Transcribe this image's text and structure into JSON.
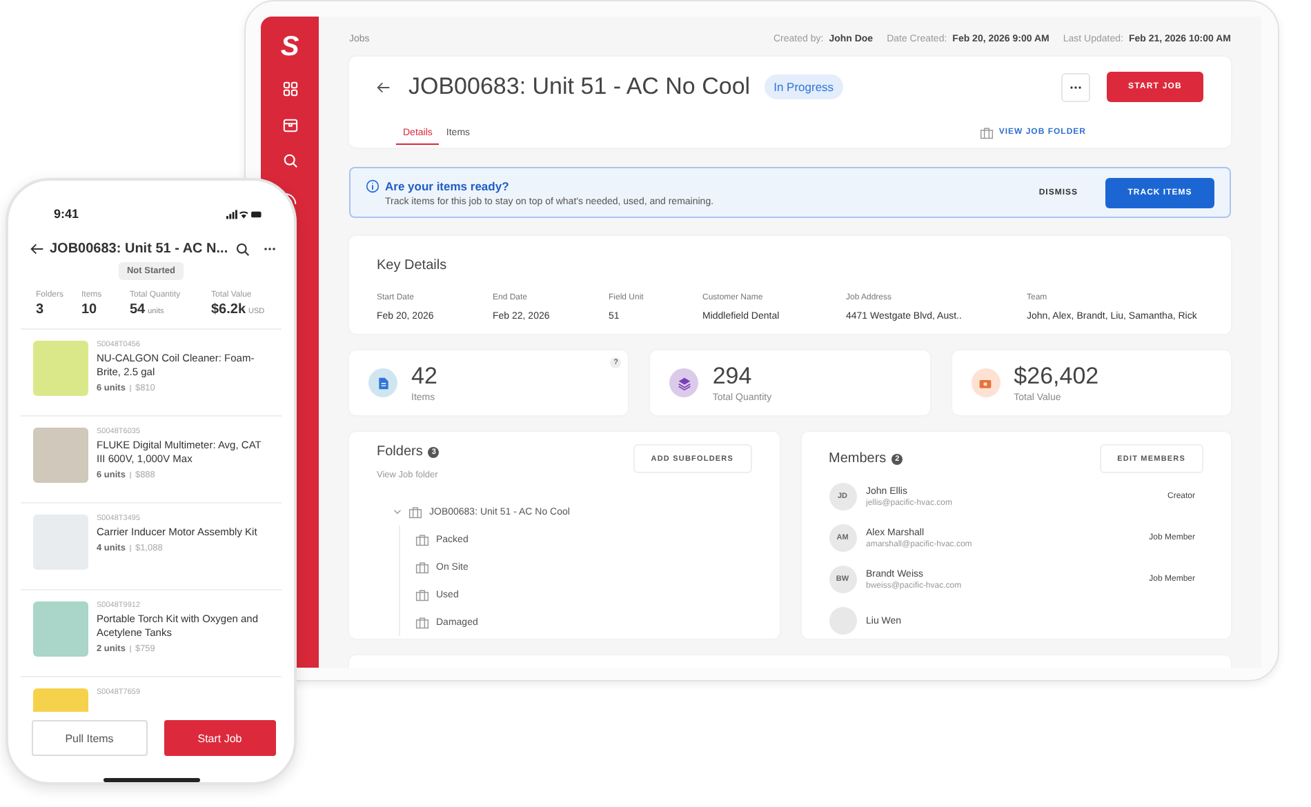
{
  "tablet": {
    "breadcrumb": "Jobs",
    "meta": [
      {
        "label": "Created by:",
        "value": "John Doe"
      },
      {
        "label": "Date Created:",
        "value": "Feb 20, 2026 9:00 AM"
      },
      {
        "label": "Last Updated:",
        "value": "Feb 21, 2026 10:00 AM"
      }
    ],
    "sidebar": {
      "logo": "S",
      "items": [
        {
          "kind": "grid"
        },
        {
          "kind": "box"
        },
        {
          "kind": "search"
        },
        {
          "kind": "signal"
        }
      ]
    },
    "job": {
      "title": "JOB00683: Unit 51 - AC No Cool",
      "status": "In Progress",
      "start_button": "START JOB",
      "folder_link": "VIEW JOB FOLDER",
      "tabs": [
        {
          "label": "Details",
          "selected": true
        },
        {
          "label": "Items",
          "selected": false
        }
      ]
    },
    "banner": {
      "title": "Are your items ready?",
      "text": "Track items for this job to stay on top of what's needed, used, and remaining.",
      "dismiss": "DISMISS",
      "action": "TRACK ITEMS"
    },
    "key_details": {
      "title": "Key Details",
      "fields": [
        {
          "label": "Start Date",
          "value": "Feb 20, 2026"
        },
        {
          "label": "End Date",
          "value": "Feb 22, 2026"
        },
        {
          "label": "Field Unit",
          "value": "51"
        },
        {
          "label": "Customer Name",
          "value": "Middlefield Dental"
        },
        {
          "label": "Job Address",
          "value": "4471 Westgate Blvd, Aust.."
        },
        {
          "label": "Team",
          "value": "John, Alex, Brandt, Liu, Samantha, Rick"
        }
      ]
    },
    "stats": [
      {
        "kind": "document",
        "value": "42",
        "label": "Items",
        "help": "?"
      },
      {
        "kind": "layers",
        "value": "294",
        "label": "Total Quantity"
      },
      {
        "kind": "money",
        "value": "$26,402",
        "label": "Total Value"
      }
    ],
    "folders": {
      "title": "Folders",
      "count": "3",
      "link": "View Job folder",
      "button": "ADD SUBFOLDERS",
      "tree": {
        "label": "JOB00683: Unit 51 - AC No Cool",
        "expanded": true,
        "children": [
          {
            "label": "Packed"
          },
          {
            "label": "On Site"
          },
          {
            "label": "Used"
          },
          {
            "label": "Damaged"
          }
        ]
      }
    },
    "members": {
      "title": "Members",
      "count": "2",
      "button": "EDIT MEMBERS",
      "list": [
        {
          "initials": "JD",
          "name": "John Ellis",
          "email": "jellis@pacific-hvac.com",
          "role": "Creator"
        },
        {
          "initials": "AM",
          "name": "Alex Marshall",
          "email": "amarshall@pacific-hvac.com",
          "role": "Job Member"
        },
        {
          "initials": "BW",
          "name": "Brandt Weiss",
          "email": "bweiss@pacific-hvac.com",
          "role": "Job Member"
        },
        {
          "name": "Liu Wen"
        }
      ]
    }
  },
  "phone": {
    "time": "9:41",
    "title": "JOB00683: Unit 51 - AC N...",
    "status": "Not Started",
    "stats": [
      {
        "label": "Folders",
        "value": "3"
      },
      {
        "label": "Items",
        "value": "10"
      },
      {
        "label": "Total Quantity",
        "value": "54",
        "unit": "units"
      },
      {
        "label": "Total Value",
        "value": "$6.2k",
        "unit": "USD"
      }
    ],
    "items": [
      {
        "sku": "S0048T0456",
        "name": "NU-CALGON Coil Cleaner: Foam-Brite, 2.5 gal",
        "units": "6 units",
        "price": "$810"
      },
      {
        "sku": "S0048T6035",
        "name": "FLUKE Digital Multimeter: Avg, CAT III 600V, 1,000V Max",
        "units": "6 units",
        "price": "$888"
      },
      {
        "sku": "S0048T3495",
        "name": "Carrier Inducer Motor Assembly Kit",
        "units": "4 units",
        "price": "$1,088"
      },
      {
        "sku": "S0048T9912",
        "name": "Portable Torch Kit with Oxygen and Acetylene Tanks",
        "units": "2 units",
        "price": "$759"
      },
      {
        "sku": "S0048T7659"
      }
    ],
    "buttons": {
      "secondary": "Pull Items",
      "primary": "Start Job"
    }
  }
}
